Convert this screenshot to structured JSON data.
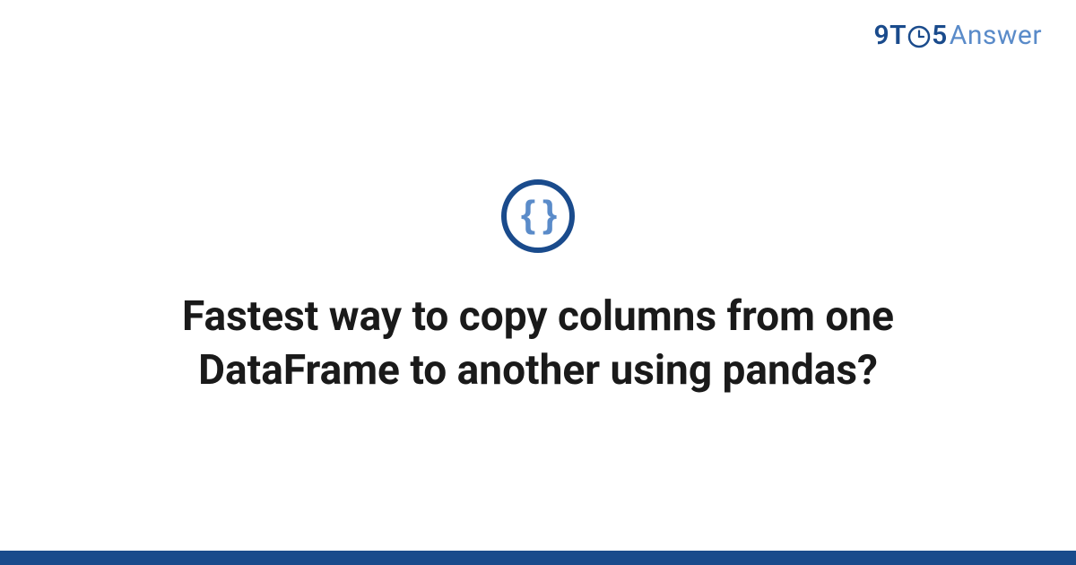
{
  "logo": {
    "nine": "9",
    "t": "T",
    "five": "5",
    "answer": "Answer"
  },
  "icon": {
    "braces": "{ }",
    "name": "code-braces-icon"
  },
  "title": "Fastest way to copy columns from one DataFrame to another using pandas?",
  "colors": {
    "primary": "#1a4b8c",
    "secondary": "#5a8bc9",
    "text": "#1a1a1a"
  }
}
